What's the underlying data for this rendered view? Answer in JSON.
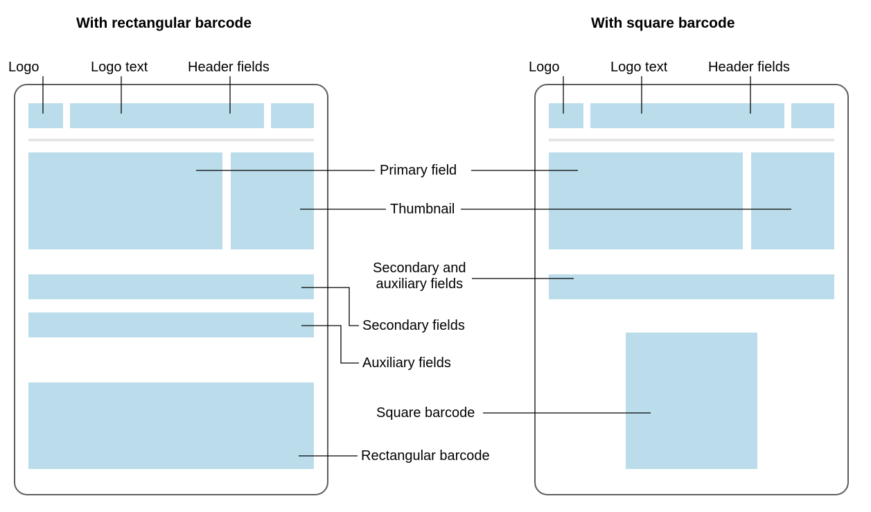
{
  "titles": {
    "left": "With rectangular barcode",
    "right": "With square barcode"
  },
  "topLabels": {
    "logo": "Logo",
    "logoText": "Logo text",
    "headerFields": "Header fields"
  },
  "callouts": {
    "primaryField": "Primary field",
    "thumbnail": "Thumbnail",
    "secondaryAux": "Secondary and\nauxiliary fields",
    "secondaryFields": "Secondary fields",
    "auxiliaryFields": "Auxiliary fields",
    "squareBarcode": "Square barcode",
    "rectBarcode": "Rectangular barcode"
  },
  "colors": {
    "block": "#bbddeb",
    "outline": "#5a5c5d",
    "divider": "#e5e5e5",
    "line": "#000000"
  }
}
